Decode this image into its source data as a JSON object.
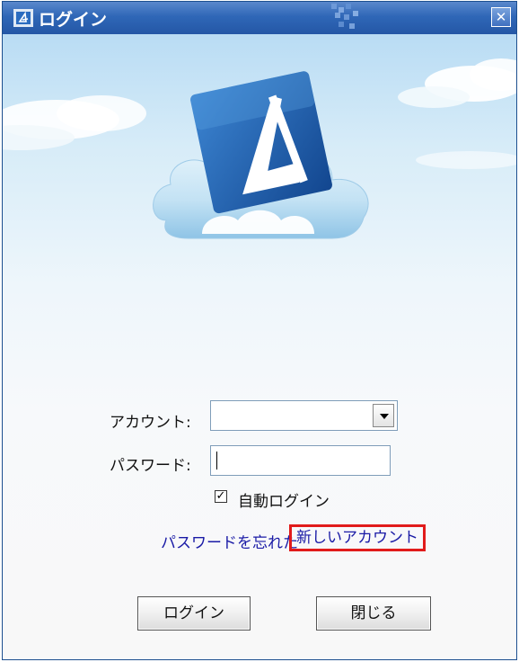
{
  "window": {
    "title": "ログイン",
    "close_label": "✕"
  },
  "form": {
    "account_label": "アカウント:",
    "account_value": "",
    "password_label": "パスワード:",
    "password_value": "",
    "auto_login_label": "自動ログイン",
    "auto_login_checked": true,
    "auto_login_mark": "✓"
  },
  "links": {
    "forgot_password": "パスワードを忘れた",
    "new_account": "新しいアカウント"
  },
  "buttons": {
    "login": "ログイン",
    "close": "閉じる"
  },
  "colors": {
    "titlebar": "#2f67b7",
    "link": "#1a1aa6",
    "highlight_box": "#e11b1b",
    "logo_blue": "#1d5fb0"
  },
  "icons": [
    "app-logo-icon",
    "close-icon",
    "dropdown-arrow-icon",
    "checkbox-check-icon",
    "cloud-logo"
  ]
}
